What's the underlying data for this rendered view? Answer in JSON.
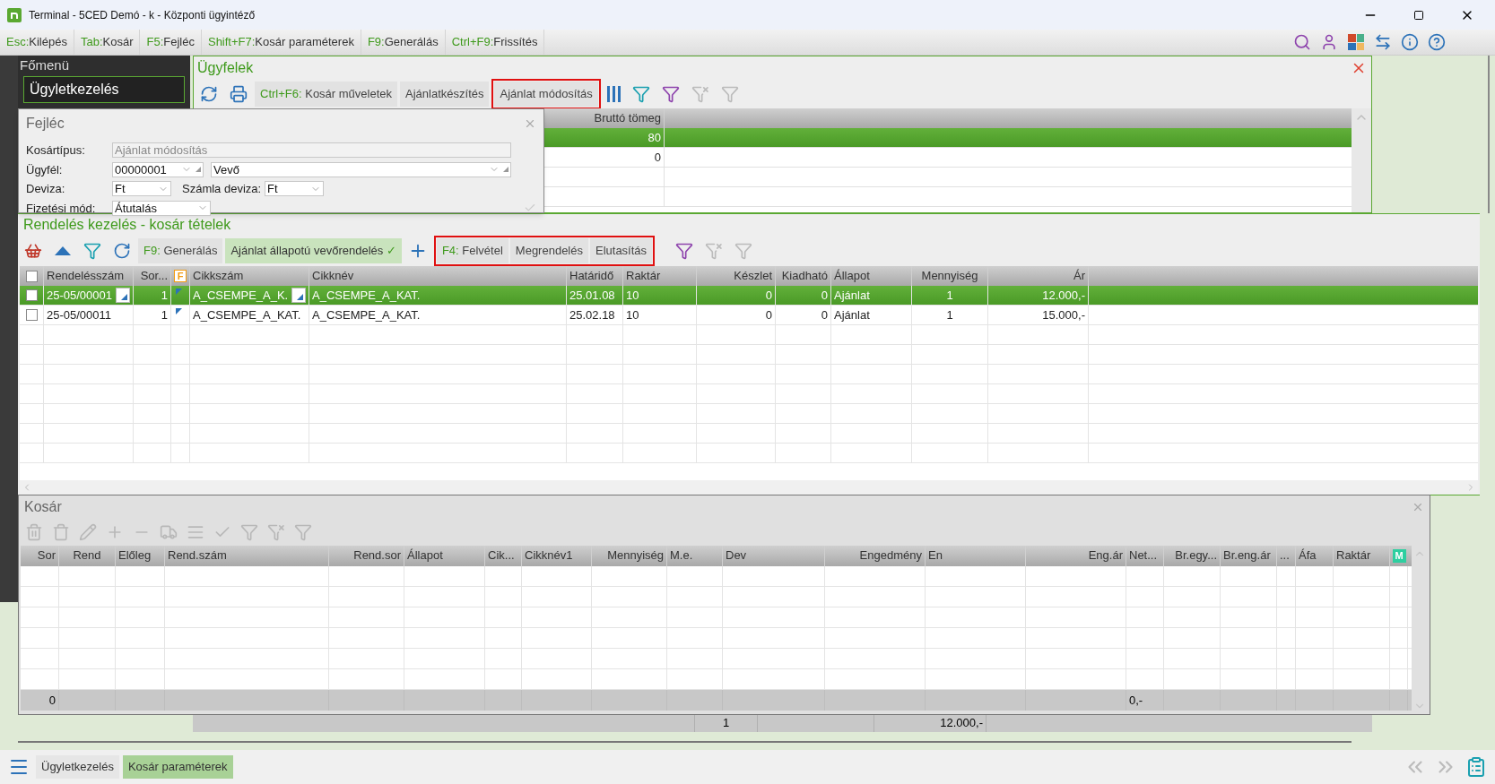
{
  "window": {
    "title": "Terminal - 5CED Demó - k - Központi ügyintéző"
  },
  "shortcuts": [
    {
      "key": "Esc:",
      "label": "Kilépés"
    },
    {
      "key": "Tab:",
      "label": "Kosár"
    },
    {
      "key": "F5:",
      "label": "Fejléc"
    },
    {
      "key": "Shift+F7:",
      "label": "Kosár paraméterek"
    },
    {
      "key": "F9:",
      "label": "Generálás"
    },
    {
      "key": "Ctrl+F9:",
      "label": "Frissítés"
    }
  ],
  "sidebar": {
    "title": "Főmenü",
    "items": [
      {
        "label": "Ügyletkezelés"
      }
    ]
  },
  "customers": {
    "title": "Ügyfelek",
    "buttons": [
      {
        "key": "Ctrl+F6:",
        "label": "Kosár műveletek",
        "outlined": false
      },
      {
        "label": "Ajánlatkészítés",
        "outlined": false
      },
      {
        "label": "Ajánlat módosítás",
        "outlined": true
      }
    ],
    "columns": [
      "Bruttó tömeg"
    ],
    "rows": [
      {
        "values": [
          "80"
        ],
        "selected": true
      },
      {
        "values": [
          "0"
        ],
        "selected": false
      }
    ]
  },
  "header_panel": {
    "title": "Fejléc",
    "basket_type": {
      "label": "Kosártípus:",
      "value": "Ajánlat módosítás",
      "disabled": true
    },
    "customer": {
      "label": "Ügyfél:",
      "code": "00000001",
      "name": "Vevő"
    },
    "currency": {
      "label": "Deviza:",
      "value": "Ft"
    },
    "invoice_currency": {
      "label": "Számla deviza:",
      "value": "Ft"
    },
    "payment": {
      "label": "Fizetési mód:",
      "value": "Átutalás"
    }
  },
  "orders": {
    "title": "Rendelés kezelés - kosár tételek",
    "buttons": [
      {
        "key": "F9:",
        "label": "Generálás",
        "kind": "button",
        "outlined": false
      },
      {
        "label": "Ajánlat állapotú vevőrendelés",
        "kind": "toggle",
        "active": true,
        "mark": "✓",
        "outlined": false
      },
      {
        "kind": "add",
        "outlined": false
      },
      {
        "key": "F4:",
        "label": "Felvétel",
        "kind": "button",
        "outlined": true
      },
      {
        "label": "Megrendelés",
        "kind": "button",
        "outlined": true
      },
      {
        "label": "Elutasítás",
        "kind": "button",
        "outlined": true
      }
    ],
    "all_checked": false,
    "columns": [
      {
        "label": "Rendelésszám",
        "picker": true
      },
      {
        "label": "Sor..."
      },
      {
        "label": "F",
        "kind": "flag"
      },
      {
        "label": "Cikkszám",
        "picker": true
      },
      {
        "label": "Cikknév"
      },
      {
        "label": "Határidő"
      },
      {
        "label": "Raktár"
      },
      {
        "label": "Készlet"
      },
      {
        "label": "Kiadható"
      },
      {
        "label": "Állapot"
      },
      {
        "label": "Mennyiség"
      },
      {
        "label": "Ár"
      }
    ],
    "rows": [
      {
        "selected": true,
        "checked": false,
        "editing": true,
        "values": [
          "25-05/00001",
          "1",
          "A_CSEMPE_A_K.",
          "A_CSEMPE_A_KAT.",
          "25.01.08",
          "10",
          "0",
          "0",
          "Ajánlat",
          "1",
          "12.000,-"
        ]
      },
      {
        "selected": false,
        "checked": false,
        "editing": false,
        "values": [
          "25-05/00011",
          "1",
          "A_CSEMPE_A_KAT.",
          "A_CSEMPE_A_KAT.",
          "25.02.18",
          "10",
          "0",
          "0",
          "Ajánlat",
          "1",
          "15.000,-"
        ]
      }
    ]
  },
  "summary": {
    "values": [
      "1",
      "12.000,-"
    ]
  },
  "basket": {
    "title": "Kosár",
    "columns": [
      {
        "label": "Sor"
      },
      {
        "label": "Rend"
      },
      {
        "label": "Előleg"
      },
      {
        "label": "Rend.szám"
      },
      {
        "label": "Rend.sor"
      },
      {
        "label": "Állapot"
      },
      {
        "label": "Cik..."
      },
      {
        "label": "Cikknév1"
      },
      {
        "label": "Mennyiség"
      },
      {
        "label": "M.e."
      },
      {
        "label": "Dev"
      },
      {
        "label": "Engedmény"
      },
      {
        "label": "En"
      },
      {
        "label": "Eng.ár"
      },
      {
        "label": "Net..."
      },
      {
        "label": "Br.egy..."
      },
      {
        "label": "Br.eng.ár"
      },
      {
        "label": "..."
      },
      {
        "label": "Áfa"
      },
      {
        "label": "Raktár"
      },
      {
        "label": "M",
        "kind": "badge"
      }
    ],
    "totals": [
      {
        "value": "0"
      },
      {
        "value": "0,-"
      }
    ]
  },
  "taskbar": {
    "items": [
      {
        "label": "Ügyletkezelés",
        "selected": false
      },
      {
        "label": "Kosár paraméterek",
        "selected": true
      }
    ]
  }
}
